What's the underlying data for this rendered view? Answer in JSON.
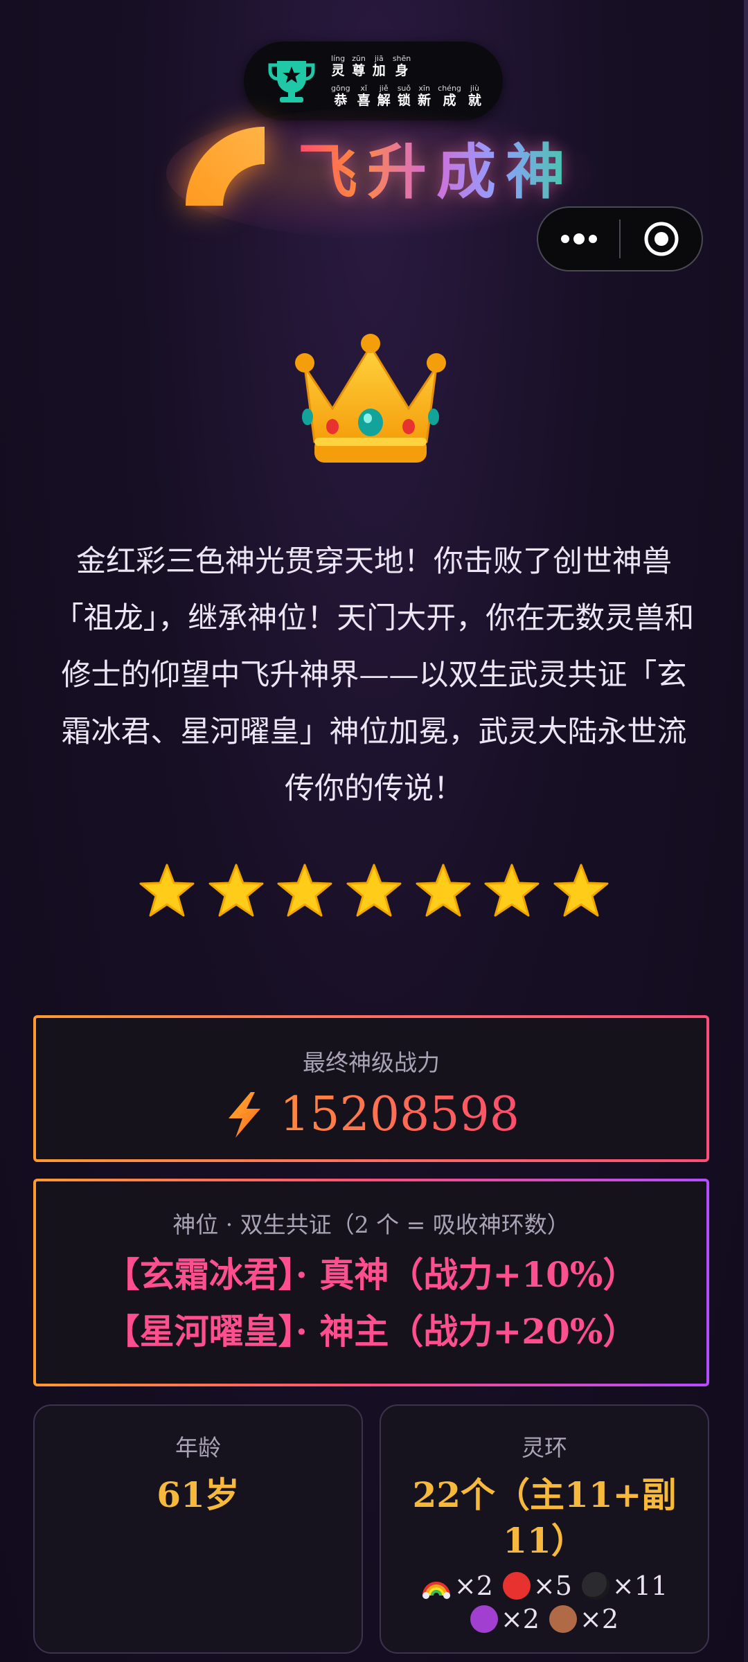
{
  "toast": {
    "line1": [
      {
        "py": "líng",
        "ch": "灵"
      },
      {
        "py": "zūn",
        "ch": "尊"
      },
      {
        "py": "jiā",
        "ch": "加"
      },
      {
        "py": "shēn",
        "ch": "身"
      }
    ],
    "line2": [
      {
        "py": "gōng",
        "ch": "恭"
      },
      {
        "py": "xǐ",
        "ch": "喜"
      },
      {
        "py": "jiě",
        "ch": "解"
      },
      {
        "py": "suǒ",
        "ch": "锁"
      },
      {
        "py": "xīn",
        "ch": "新"
      },
      {
        "py": "chéng",
        "ch": "成"
      },
      {
        "py": "jiù",
        "ch": "就"
      }
    ],
    "icon": "trophy-icon",
    "icon_color": "#1fc9a8"
  },
  "banner": {
    "title": "飞升成神",
    "icon": "quarter-circle-icon"
  },
  "capsule": {
    "more_icon": "more-dots-icon",
    "close_icon": "target-circle-icon"
  },
  "crown": {
    "icon": "crown-icon"
  },
  "story": {
    "text": "金红彩三色神光贯穿天地！你击败了创世神兽「祖龙」，继承神位！天门大开，你在无数灵兽和修士的仰望中飞升神界——以双生武灵共证「玄霜冰君、星河曜皇」神位加冕，武灵大陆永世流传你的传说！"
  },
  "rating": {
    "stars": 7,
    "max": 7
  },
  "power": {
    "label": "最终神级战力",
    "icon": "lightning-icon",
    "value": "15208598"
  },
  "god": {
    "label": "神位 · 双生共证（2 个 = 吸收神环数）",
    "lines": [
      "【玄霜冰君】· 真神（战力+10%）",
      "【星河曜皇】· 神主（战力+20%）"
    ]
  },
  "age": {
    "label": "年龄",
    "value": "61岁"
  },
  "rings": {
    "label": "灵环",
    "value": "22个（主11+副11）",
    "items": [
      {
        "icon": "rainbow-icon",
        "count": "×2"
      },
      {
        "icon": "red-circle-icon",
        "count": "×5",
        "color": "#e8322f"
      },
      {
        "icon": "black-circle-icon",
        "count": "×11",
        "color": "#2b2b2f"
      },
      {
        "icon": "purple-circle-icon",
        "count": "×2",
        "color": "#a13fd1"
      },
      {
        "icon": "brown-circle-icon",
        "count": "×2",
        "color": "#b06a45"
      }
    ]
  },
  "colors": {
    "background": "#170f24",
    "gold": "#f6b93b",
    "pink": "#ff4f8f",
    "power": "#ff6a55"
  }
}
